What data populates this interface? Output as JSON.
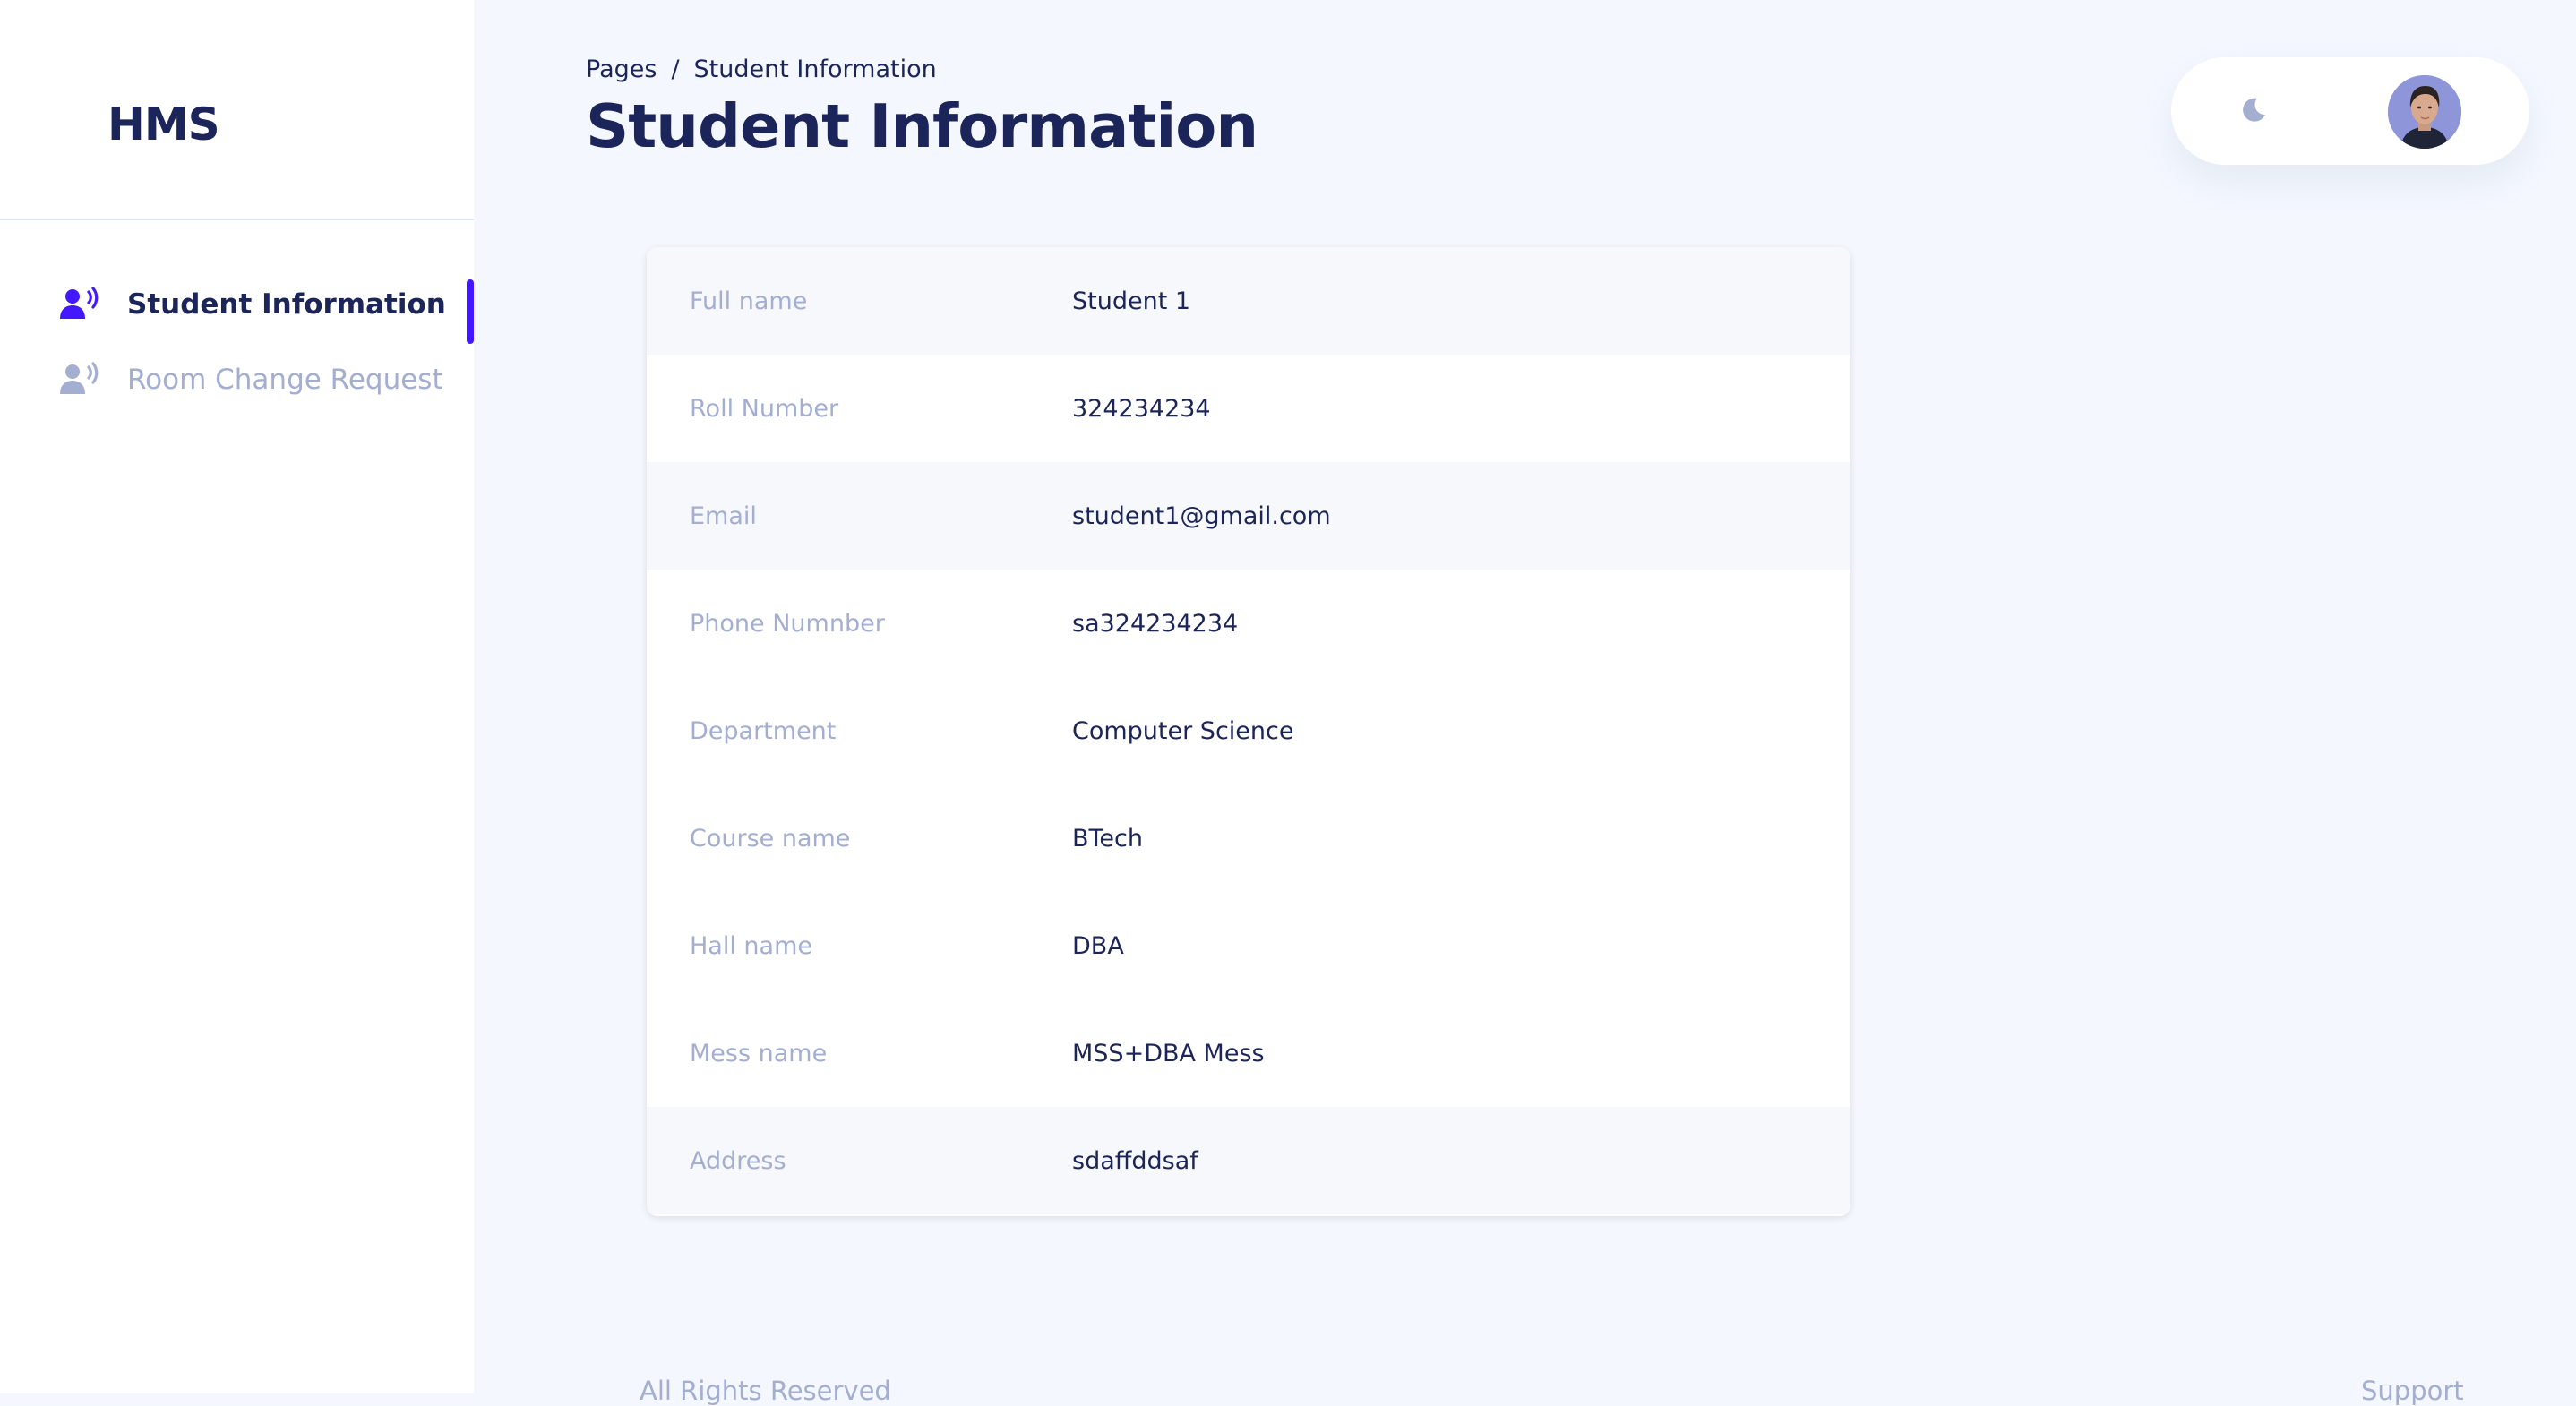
{
  "sidebar": {
    "brand": "HMS",
    "items": [
      {
        "label": "Student Information",
        "icon": "user-voice-icon",
        "active": true
      },
      {
        "label": "Room Change Request",
        "icon": "user-voice-icon",
        "active": false
      }
    ]
  },
  "header": {
    "breadcrumb": {
      "root": "Pages",
      "separator": "/",
      "current": "Student Information"
    },
    "title": "Student Information",
    "theme_toggle_icon": "moon-icon",
    "avatar_icon": "user-avatar"
  },
  "student_info": {
    "rows": [
      {
        "label": "Full name",
        "value": "Student 1"
      },
      {
        "label": "Roll Number",
        "value": "324234234"
      },
      {
        "label": "Email",
        "value": "student1@gmail.com"
      },
      {
        "label": "Phone Numnber",
        "value": "sa324234234"
      },
      {
        "label": "Department",
        "value": "Computer Science"
      },
      {
        "label": "Course name",
        "value": "BTech"
      },
      {
        "label": "Hall name",
        "value": "DBA"
      },
      {
        "label": "Mess name",
        "value": "MSS+DBA Mess"
      },
      {
        "label": "Address",
        "value": "sdaffddsaf"
      }
    ]
  },
  "footer": {
    "left": "All Rights Reserved",
    "right": "Support"
  },
  "colors": {
    "accent": "#4318ff",
    "text_primary": "#1b2559",
    "text_muted": "#a3aed0",
    "background": "#f4f7fe"
  }
}
